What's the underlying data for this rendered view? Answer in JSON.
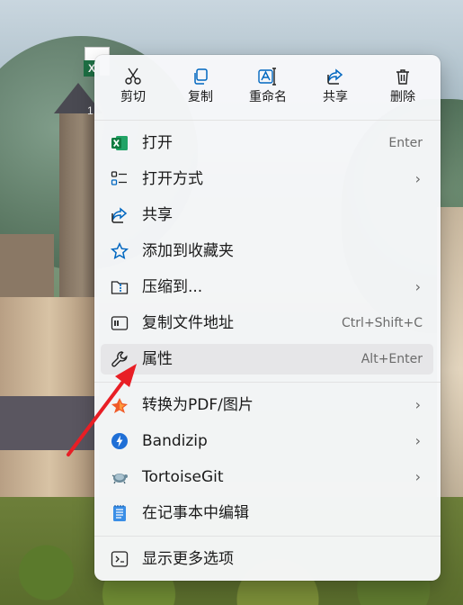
{
  "quick_actions": [
    {
      "label": "剪切",
      "icon": "scissors-icon"
    },
    {
      "label": "复制",
      "icon": "copy-icon"
    },
    {
      "label": "重命名",
      "icon": "rename-icon"
    },
    {
      "label": "共享",
      "icon": "share-icon"
    },
    {
      "label": "删除",
      "icon": "trash-icon"
    }
  ],
  "menu_items": [
    {
      "label": "打开",
      "shortcut": "Enter",
      "icon": "excel-icon"
    },
    {
      "label": "打开方式",
      "submenu": true,
      "icon": "open-with-icon"
    },
    {
      "label": "共享",
      "icon": "share-icon"
    },
    {
      "label": "添加到收藏夹",
      "icon": "star-icon"
    },
    {
      "label": "压缩到...",
      "submenu": true,
      "icon": "zip-folder-icon"
    },
    {
      "label": "复制文件地址",
      "shortcut": "Ctrl+Shift+C",
      "icon": "copy-path-icon"
    },
    {
      "label": "属性",
      "shortcut": "Alt+Enter",
      "icon": "wrench-icon",
      "highlighted": true
    },
    {
      "label": "转换为PDF/图片",
      "submenu": true,
      "icon": "pdf-convert-icon"
    },
    {
      "label": "Bandizip",
      "submenu": true,
      "icon": "bandizip-icon"
    },
    {
      "label": "TortoiseGit",
      "submenu": true,
      "icon": "tortoisegit-icon"
    },
    {
      "label": "在记事本中编辑",
      "icon": "notepad-icon"
    },
    {
      "label": "显示更多选项",
      "icon": "more-options-icon"
    }
  ],
  "desktop": {
    "icon_label": "1",
    "file_badge": "X"
  },
  "colors": {
    "accent": "#0067c0",
    "highlight": "#e6e6e8",
    "arrow": "#e81e25"
  }
}
